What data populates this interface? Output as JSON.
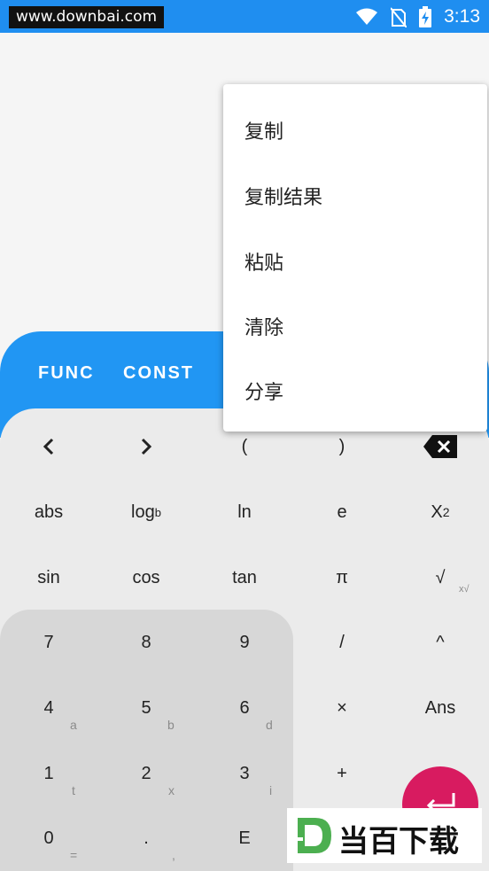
{
  "status_bar": {
    "watermark_url": "www.downbai.com",
    "time": "3:13"
  },
  "tabs": {
    "func": "FUNC",
    "const": "CONST"
  },
  "keys": {
    "row1": {
      "left": "<",
      "right": ">",
      "open_paren": "(",
      "close_paren": ")"
    },
    "row2": {
      "abs": "abs",
      "log_base": "log",
      "log_sub": "b",
      "ln": "ln",
      "e": "e",
      "x": "X",
      "x_sup": "2"
    },
    "row3": {
      "sin": "sin",
      "cos": "cos",
      "tan": "tan",
      "pi": "π",
      "sqrt": "√",
      "sqrt_sub": "x√"
    },
    "row4": {
      "seven": "7",
      "eight": "8",
      "nine": "9",
      "divide": "/",
      "caret": "^"
    },
    "row5": {
      "four": "4",
      "four_sub": "a",
      "five": "5",
      "five_sub": "b",
      "six": "6",
      "six_sub": "d",
      "multiply": "×",
      "ans": "Ans"
    },
    "row6": {
      "one": "1",
      "one_sub": "t",
      "two": "2",
      "two_sub": "x",
      "three": "3",
      "three_sub": "i",
      "plus": "+"
    },
    "row7": {
      "zero": "0",
      "zero_sub": "=",
      "dot": ".",
      "dot_sub": ",",
      "exp": "E"
    }
  },
  "context_menu": {
    "items": [
      "复制",
      "复制结果",
      "粘贴",
      "清除",
      "分享"
    ]
  },
  "brand_watermark": {
    "text": "当百下载"
  },
  "colors": {
    "primary": "#2196f3",
    "accent": "#d81b60",
    "key_bg": "#ebebeb",
    "numpad_bg": "#d7d7d7"
  }
}
